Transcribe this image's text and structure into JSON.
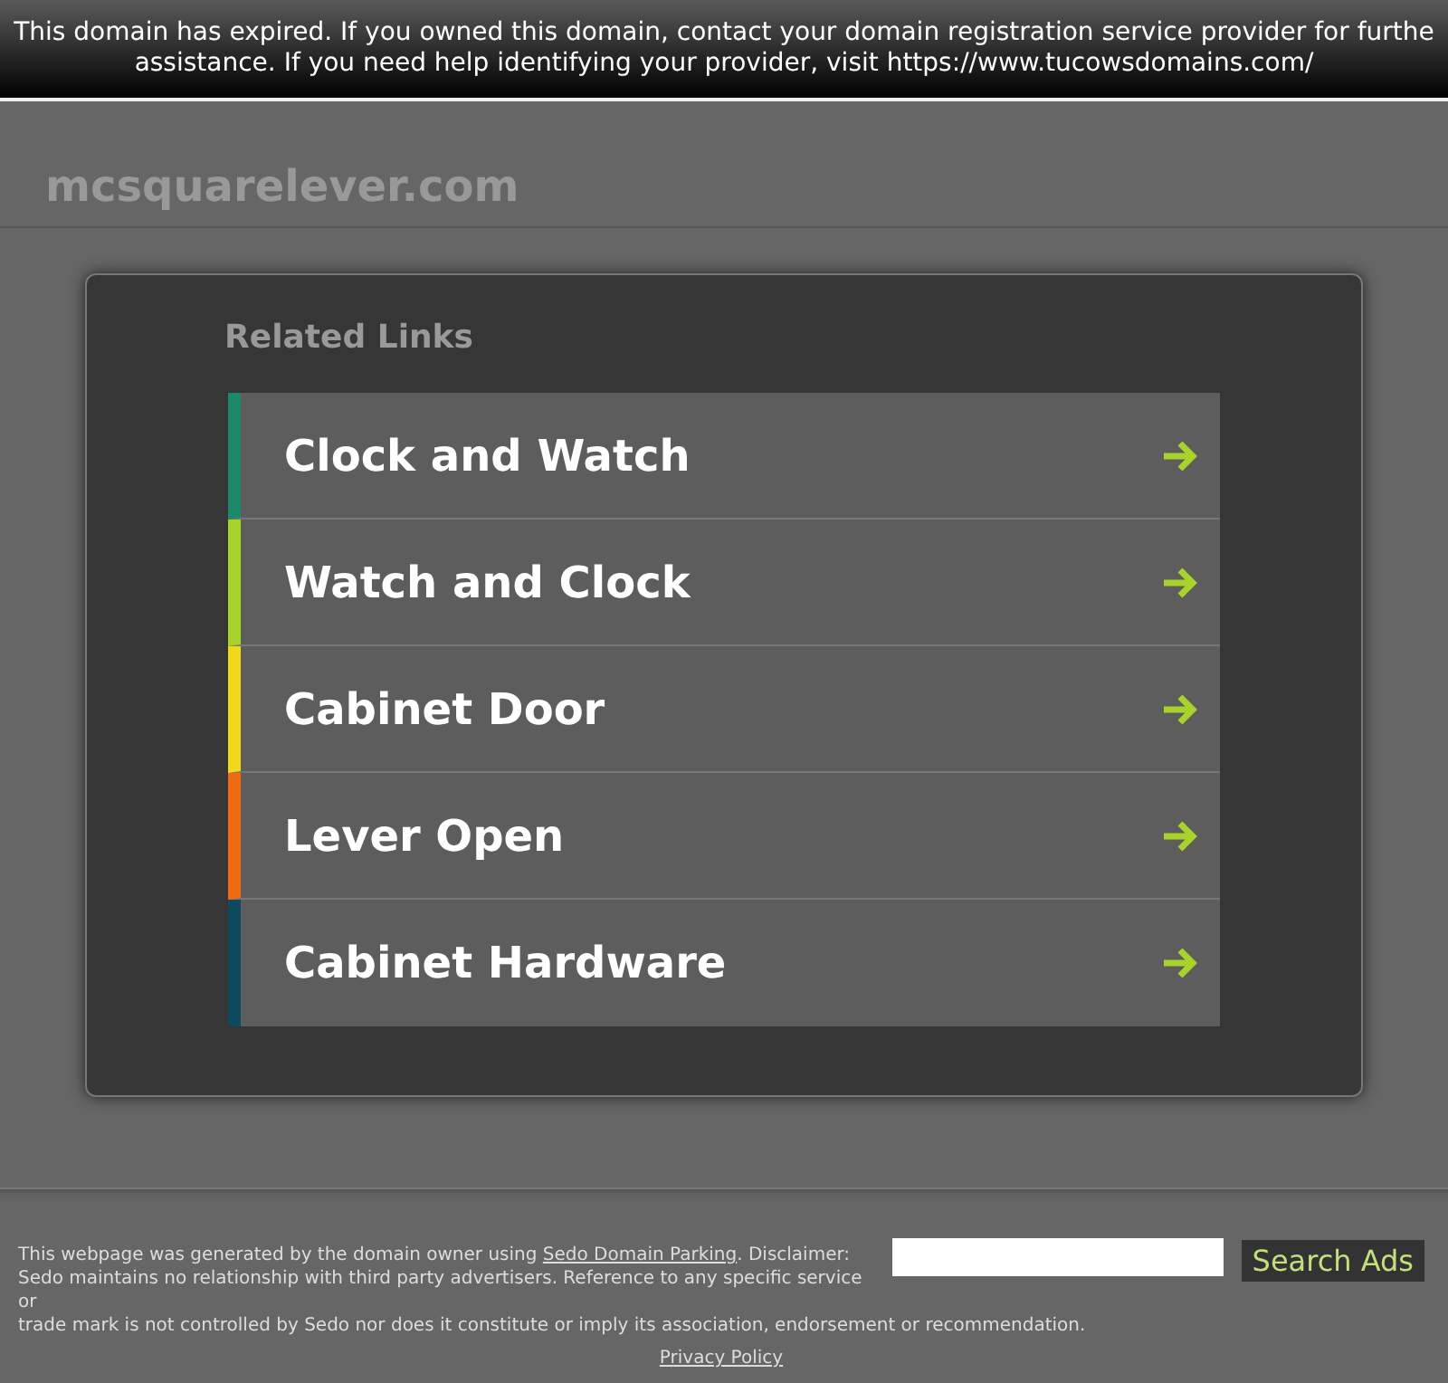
{
  "banner": {
    "lines": [
      "This domain has expired. If you owned this domain, contact your domain registration service provider for furthe",
      "assistance. If you need help identifying your provider, visit https://www.tucowsdomains.com/"
    ]
  },
  "domain": "mcsquarelever.com",
  "related": {
    "title": "Related Links",
    "links": [
      {
        "label": "Clock and Watch",
        "color": "#1b8a6b"
      },
      {
        "label": "Watch and Clock",
        "color": "#a8d42a"
      },
      {
        "label": "Cabinet Door",
        "color": "#f2d81a"
      },
      {
        "label": "Lever Open",
        "color": "#f06a10"
      },
      {
        "label": "Cabinet Hardware",
        "color": "#0e4a5e"
      }
    ]
  },
  "footer": {
    "before": "This webpage was generated by the domain owner using ",
    "link": "Sedo Domain Parking",
    "after": ". Disclaimer: Sedo maintains no relationship with third party advertisers. Reference to any specific service or",
    "continued": "trade mark is not controlled by Sedo nor does it constitute or imply its association, endorsement or recommendation.",
    "search_button": "Search Ads",
    "privacy": "Privacy Policy"
  }
}
